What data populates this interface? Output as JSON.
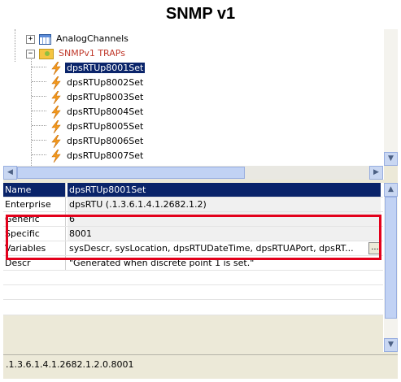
{
  "page": {
    "title": "SNMP v1"
  },
  "tree": {
    "analog": {
      "label": "AnalogChannels",
      "icon": "grid-icon"
    },
    "traps": {
      "label": "SNMPv1 TRAPs",
      "icon": "folder-icon"
    },
    "children": [
      {
        "label": "dpsRTUp8001Set"
      },
      {
        "label": "dpsRTUp8002Set"
      },
      {
        "label": "dpsRTUp8003Set"
      },
      {
        "label": "dpsRTUp8004Set"
      },
      {
        "label": "dpsRTUp8005Set"
      },
      {
        "label": "dpsRTUp8006Set"
      },
      {
        "label": "dpsRTUp8007Set"
      }
    ]
  },
  "properties": {
    "rows": [
      {
        "name": "Name",
        "value": "dpsRTUp8001Set"
      },
      {
        "name": "Enterprise",
        "value": "dpsRTU (.1.3.6.1.4.1.2682.1.2)"
      },
      {
        "name": "Generic",
        "value": "6"
      },
      {
        "name": "Specific",
        "value": "8001"
      },
      {
        "name": "Variables",
        "value": "sysDescr, sysLocation, dpsRTUDateTime, dpsRTUAPort, dpsRT...",
        "button": "..."
      },
      {
        "name": "Descr",
        "value": "\"Generated when discrete point 1 is set.\""
      }
    ]
  },
  "status": {
    "oid": ".1.3.6.1.4.1.2682.1.2.0.8001"
  },
  "colors": {
    "selection": "#0a246a",
    "highlight": "#e3001b",
    "trap_folder_text": "#c0392b"
  }
}
